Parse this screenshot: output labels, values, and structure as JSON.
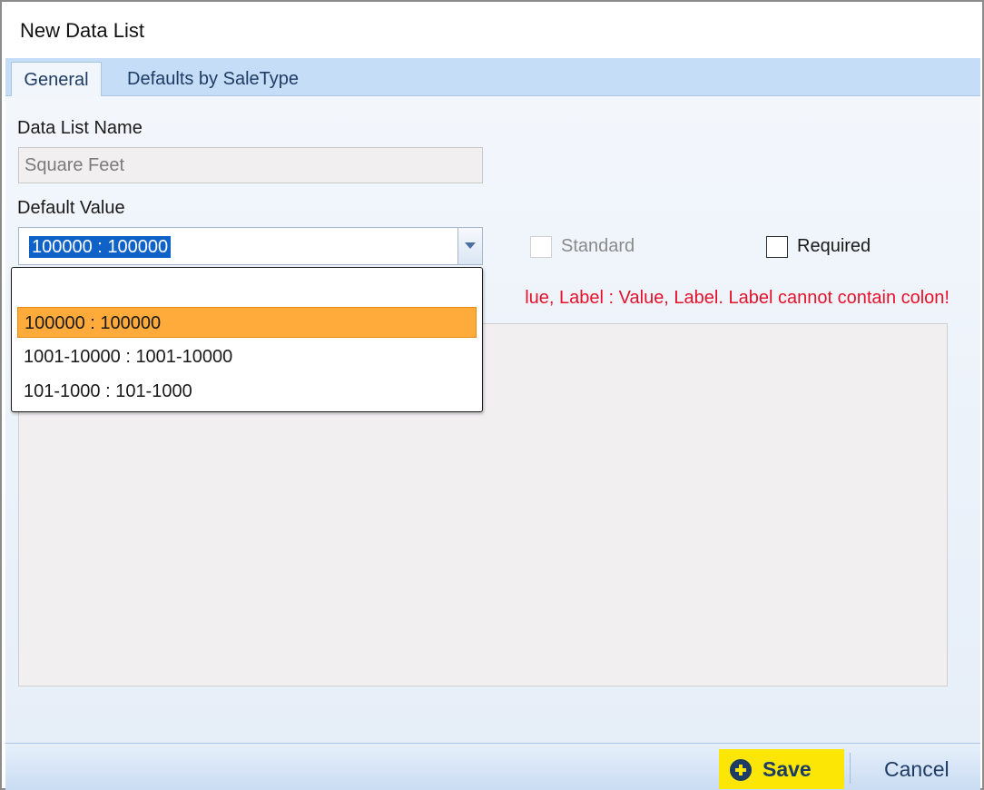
{
  "window": {
    "title": "New Data List"
  },
  "tabs": [
    {
      "label": "General",
      "active": true
    },
    {
      "label": "Defaults by SaleType",
      "active": false
    }
  ],
  "form": {
    "name_label": "Data List Name",
    "name_value": "Square Feet",
    "default_label": "Default Value",
    "default_value": "100000 : 100000",
    "standard_label": "Standard",
    "standard_checked": false,
    "standard_enabled": false,
    "required_label": "Required",
    "required_checked": false,
    "hint_text": "lue, Label : Value, Label. Label cannot contain colon!"
  },
  "dropdown": {
    "items": [
      {
        "label": "",
        "selected": false
      },
      {
        "label": "100000 : 100000",
        "selected": true
      },
      {
        "label": "1001-10000 : 1001-10000",
        "selected": false
      },
      {
        "label": "101-1000 : 101-1000",
        "selected": false
      }
    ]
  },
  "footer": {
    "save_label": "Save",
    "cancel_label": "Cancel"
  },
  "colors": {
    "accent": "#fbe606",
    "selection": "#ffab3b",
    "error": "#e5102a",
    "tab_bar": "#c5ddf6"
  },
  "icons": {
    "save": "plus-circle-icon",
    "dropdown": "chevron-down-icon"
  }
}
